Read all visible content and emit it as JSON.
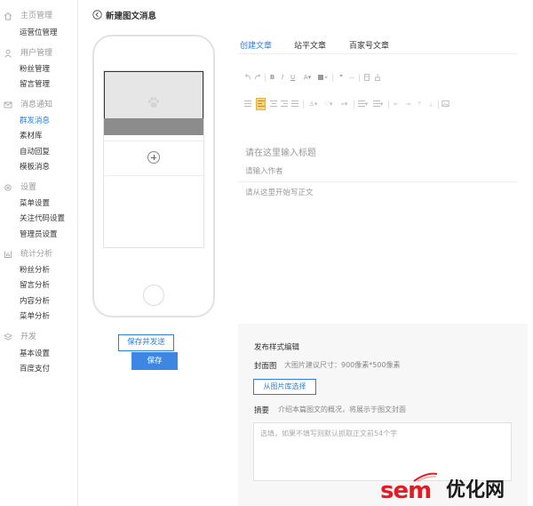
{
  "sidebar": {
    "sections": [
      {
        "title": "主页管理",
        "icon": "home-icon",
        "items": [
          {
            "label": "运营位管理",
            "active": false
          }
        ]
      },
      {
        "title": "用户管理",
        "icon": "user-icon",
        "items": [
          {
            "label": "粉丝管理",
            "active": false
          },
          {
            "label": "留言管理",
            "active": false
          }
        ]
      },
      {
        "title": "消息通知",
        "icon": "mail-icon",
        "items": [
          {
            "label": "群发消息",
            "active": true
          },
          {
            "label": "素材库",
            "active": false
          },
          {
            "label": "自动回复",
            "active": false
          },
          {
            "label": "模板消息",
            "active": false
          }
        ]
      },
      {
        "title": "设置",
        "icon": "gear-icon",
        "items": [
          {
            "label": "菜单设置",
            "active": false
          },
          {
            "label": "关注代码设置",
            "active": false
          },
          {
            "label": "管理员设置",
            "active": false
          }
        ]
      },
      {
        "title": "统计分析",
        "icon": "chart-icon",
        "items": [
          {
            "label": "粉丝分析",
            "active": false
          },
          {
            "label": "留言分析",
            "active": false
          },
          {
            "label": "内容分析",
            "active": false
          },
          {
            "label": "菜单分析",
            "active": false
          }
        ]
      },
      {
        "title": "开发",
        "icon": "layers-icon",
        "items": [
          {
            "label": "基本设置",
            "active": false
          },
          {
            "label": "百度支付",
            "active": false
          }
        ]
      }
    ]
  },
  "header": {
    "title": "新建图文消息"
  },
  "buttons": {
    "save_and_send": "保存并发送",
    "save": "保存"
  },
  "tabs": [
    {
      "label": "创建文章",
      "active": true
    },
    {
      "label": "站平文章",
      "active": false
    },
    {
      "label": "百家号文章",
      "active": false
    }
  ],
  "editor": {
    "title_placeholder": "请在这里输入标题",
    "author_placeholder": "请输入作者",
    "body_placeholder": "请从这里开始写正文"
  },
  "publish": {
    "section_title": "发布样式编辑",
    "cover_label": "封面图",
    "cover_hint": "大图片建议尺寸：900像素*500像素",
    "choose_button": "从图片库选择",
    "summary_label": "摘要",
    "summary_hint": "介绍本篇图文的概况，将展示于图文封面",
    "summary_placeholder": "选填，如果不填写则默认抓取正文前54个字"
  },
  "watermark": {
    "latin": "sem",
    "chinese": "优化网"
  },
  "colors": {
    "accent": "#2e7ed8",
    "primary_button": "#3d87e3",
    "watermark_red": "#e31b23"
  }
}
